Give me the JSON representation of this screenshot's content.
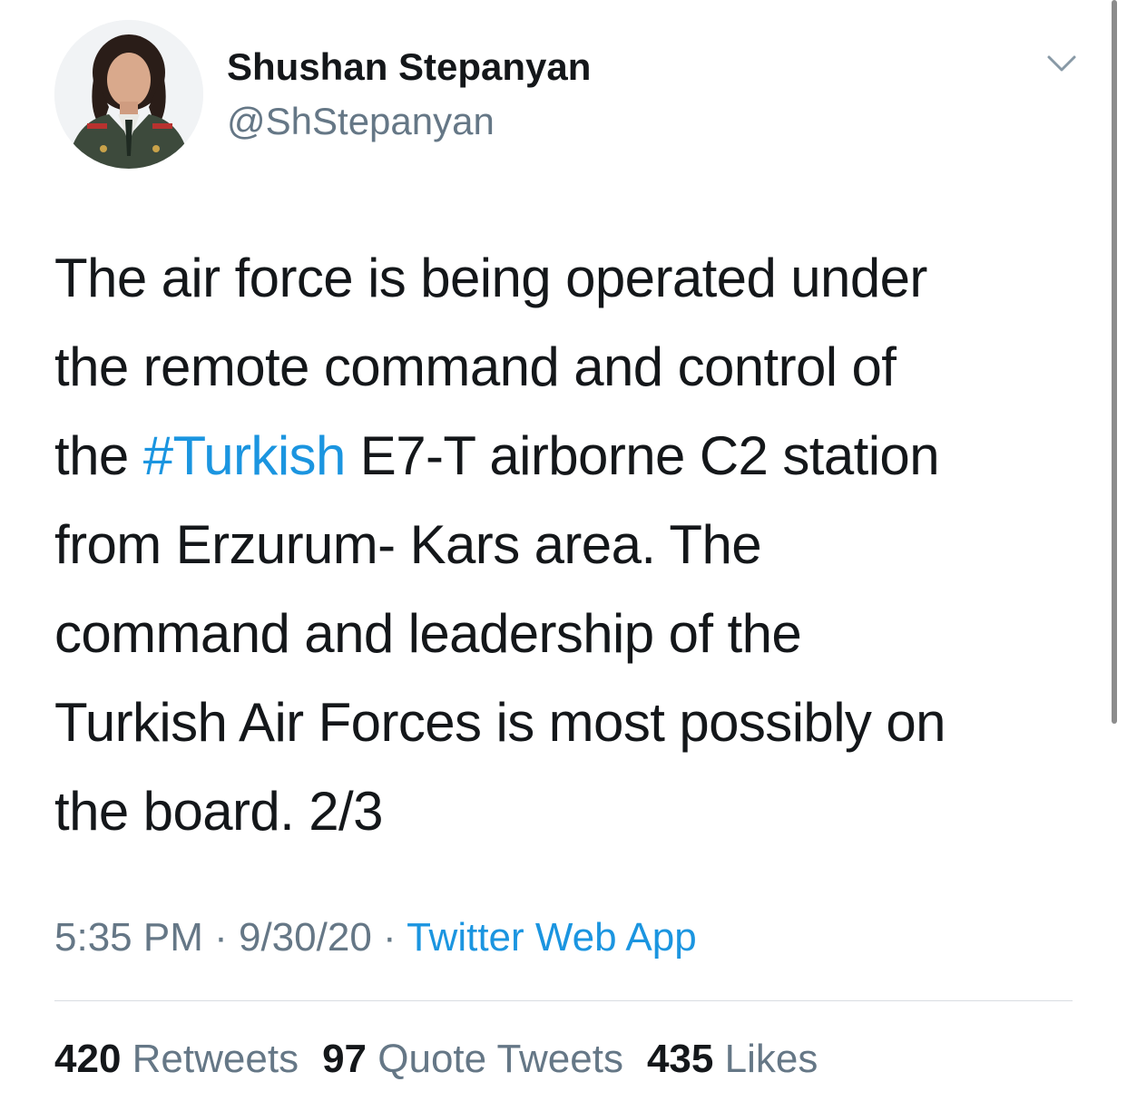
{
  "user": {
    "display_name": "Shushan Stepanyan",
    "handle": "@ShStepanyan"
  },
  "tweet": {
    "lines": [
      "The air force is being operated under",
      "the remote command and control of",
      {
        "before": "the ",
        "hashtag": "#Turkish",
        "after": " E7-T airborne C2 station"
      },
      "from Erzurum- Kars area. The",
      "command and leadership of the",
      "Turkish Air Forces is most possibly on",
      "the board. 2/3"
    ]
  },
  "meta": {
    "time": "5:35 PM",
    "separator": " · ",
    "date": "9/30/20",
    "source": "Twitter Web App"
  },
  "stats": {
    "retweets_count": "420",
    "retweets_label": "Retweets",
    "quotes_count": "97",
    "quotes_label": "Quote Tweets",
    "likes_count": "435",
    "likes_label": "Likes"
  },
  "colors": {
    "link": "#1b95e0",
    "secondary_text": "#657786",
    "primary_text": "#14171a"
  },
  "icons": {
    "menu": "chevron-down-icon"
  }
}
